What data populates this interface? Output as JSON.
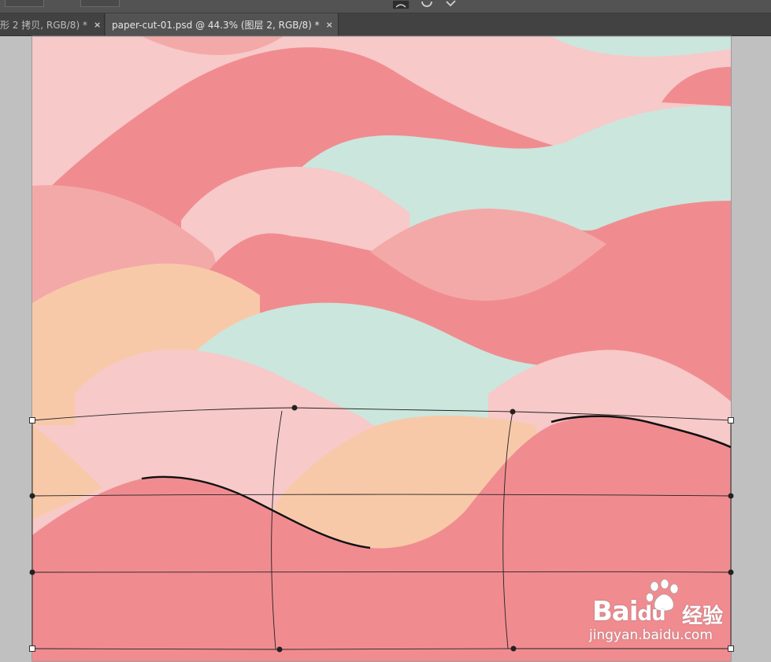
{
  "tabs": [
    {
      "label": "形 2 拷贝, RGB/8) *",
      "close": "×",
      "active": false
    },
    {
      "label": "paper-cut-01.psd @ 44.3% (图层 2, RGB/8) *",
      "close": "×",
      "active": true
    }
  ],
  "options_bar": {
    "icons": [
      "warp-icon",
      "reset-icon",
      "commit-check-icon"
    ]
  },
  "document": {
    "name": "paper-cut-01.psd",
    "zoom": "44.3%",
    "layer": "图层 2",
    "mode": "RGB/8",
    "palette": {
      "pink_light": "#f7c9c8",
      "coral": "#f08c90",
      "salmon": "#f3a9a8",
      "mint": "#cbe6dd",
      "peach": "#f8c9a9",
      "pasteboard": "#c0c0c0"
    }
  },
  "transform": {
    "type": "warp",
    "grid": "3x3"
  },
  "watermark": {
    "brand": "Bai",
    "brand_suffix": "du",
    "chinese": "经验",
    "url": "jingyan.baidu.com"
  }
}
